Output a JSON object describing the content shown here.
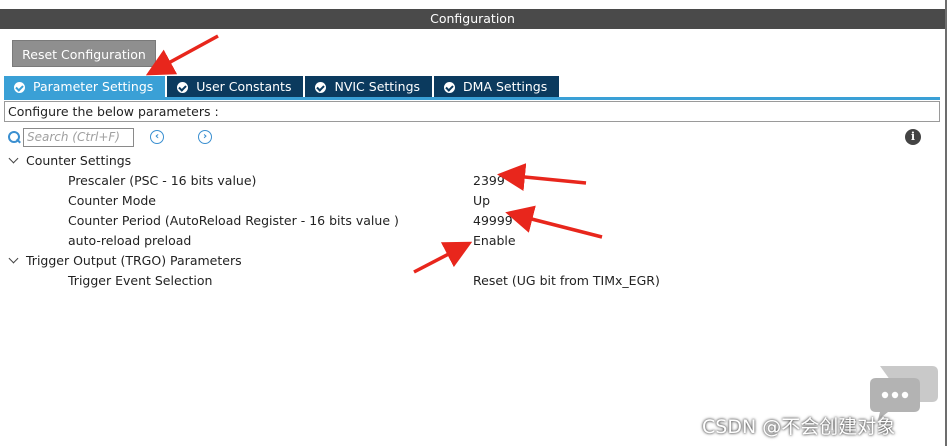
{
  "window": {
    "title": "Configuration"
  },
  "toolbar": {
    "reset_label": "Reset Configuration"
  },
  "tabs": [
    {
      "label": "Parameter Settings",
      "active": true,
      "icon": "check-circle-icon"
    },
    {
      "label": "User Constants",
      "active": false,
      "icon": "check-circle-icon"
    },
    {
      "label": "NVIC Settings",
      "active": false,
      "icon": "check-circle-icon"
    },
    {
      "label": "DMA Settings",
      "active": false,
      "icon": "check-circle-icon"
    }
  ],
  "configure_label": "Configure the below parameters :",
  "search": {
    "placeholder": "Search (Ctrl+F)",
    "value": ""
  },
  "groups": [
    {
      "name": "Counter Settings",
      "params": [
        {
          "name": "Prescaler (PSC - 16 bits value)",
          "value": "2399"
        },
        {
          "name": "Counter Mode",
          "value": "Up"
        },
        {
          "name": "Counter Period (AutoReload Register - 16 bits value )",
          "value": "49999"
        },
        {
          "name": "auto-reload preload",
          "value": "Enable"
        }
      ]
    },
    {
      "name": "Trigger Output (TRGO) Parameters",
      "params": [
        {
          "name": "Trigger Event Selection",
          "value": "Reset (UG bit from TIMx_EGR)"
        }
      ]
    }
  ],
  "watermark": "CSDN @不会创建对象",
  "colors": {
    "title_bar": "#4a4a4a",
    "tab_active": "#3aa0d6",
    "tab_inactive": "#0b3a5e",
    "reset_button": "#8f8f8f",
    "annotation_arrow": "#e8261c"
  }
}
